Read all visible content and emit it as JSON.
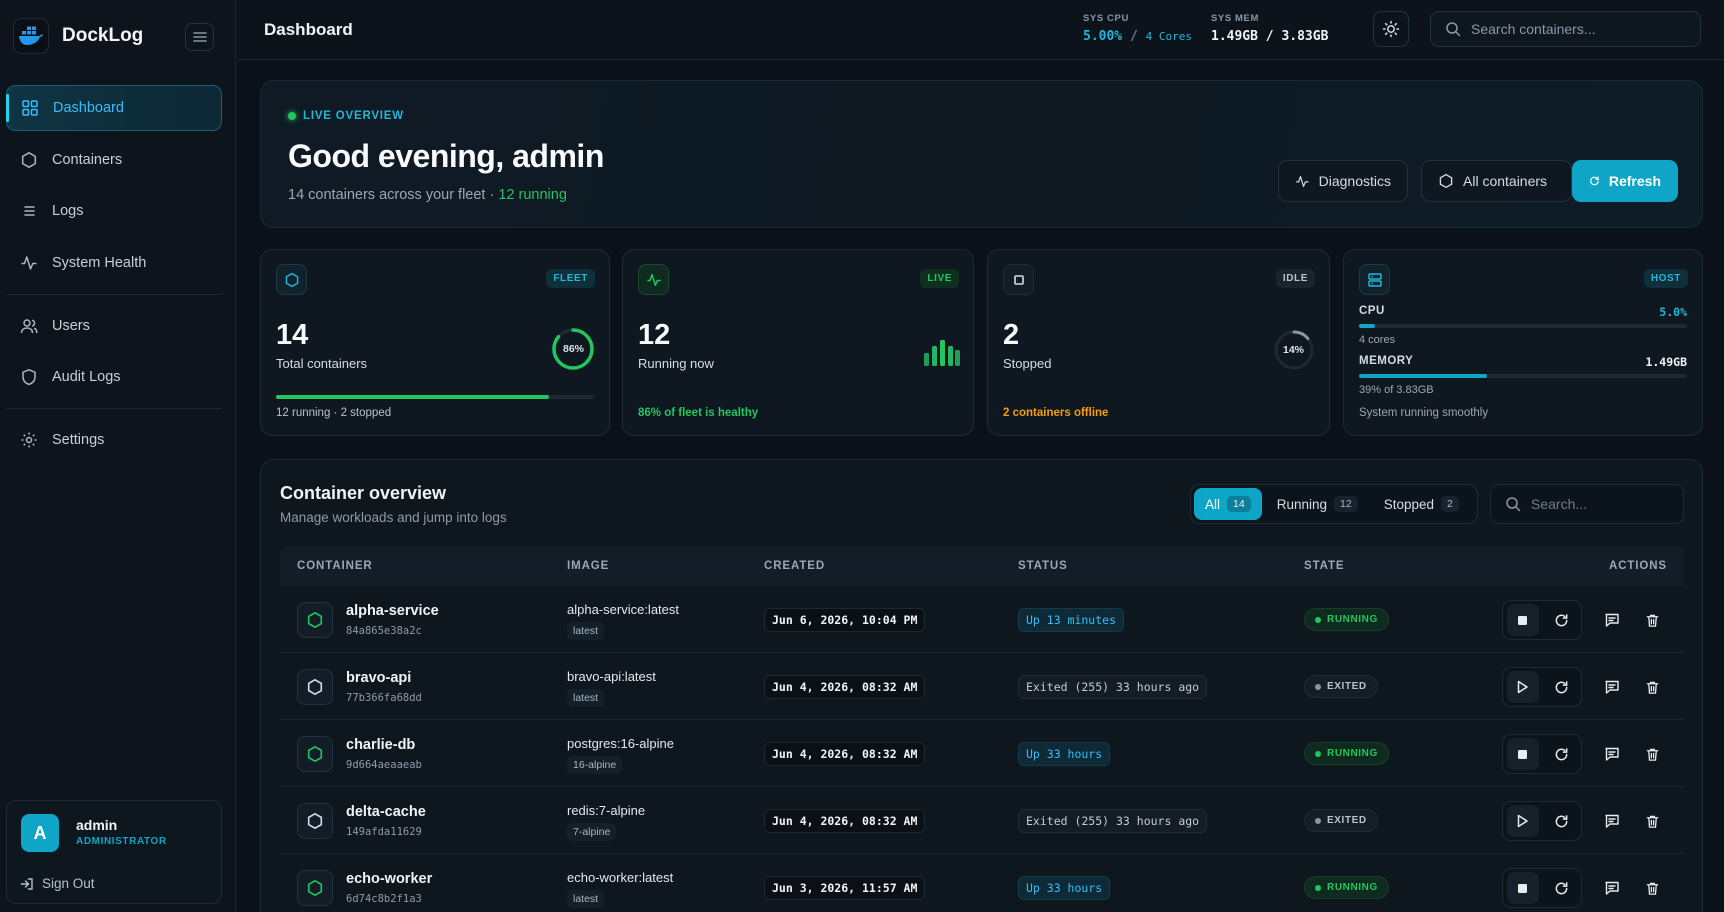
{
  "brand": {
    "name": "DockLog"
  },
  "sidebar": {
    "items": [
      {
        "label": "Dashboard",
        "icon": "grid-icon",
        "active": true
      },
      {
        "label": "Containers",
        "icon": "hexagon-icon"
      },
      {
        "label": "Logs",
        "icon": "list-icon"
      },
      {
        "label": "System Health",
        "icon": "activity-icon"
      },
      {
        "label": "Users",
        "icon": "users-icon"
      },
      {
        "label": "Audit Logs",
        "icon": "shield-icon"
      },
      {
        "label": "Settings",
        "icon": "gear-icon"
      }
    ],
    "user": {
      "initial": "A",
      "name": "admin",
      "role": "ADMINISTRATOR",
      "signout": "Sign Out"
    }
  },
  "topbar": {
    "title": "Dashboard",
    "cpu_label": "SYS CPU",
    "cpu_value": "5.00%",
    "cpu_sep": " / ",
    "cpu_cores": "4 Cores",
    "mem_label": "SYS MEM",
    "mem_value": "1.49GB / 3.83GB",
    "search_placeholder": "Search containers..."
  },
  "hero": {
    "tag": "LIVE OVERVIEW",
    "greeting": "Good evening, admin",
    "subtitle": "14 containers across your fleet ·",
    "running_text": "12 running",
    "buttons": {
      "diagnostics": "Diagnostics",
      "all_containers": "All containers",
      "refresh": "Refresh"
    }
  },
  "cards": {
    "fleet": {
      "pill": "FLEET",
      "value": "14",
      "label": "Total containers",
      "ring": "86%",
      "ring_pct": 86,
      "foot": "12 running · 2 stopped",
      "progress_pct": 86
    },
    "live": {
      "pill": "LIVE",
      "value": "12",
      "label": "Running now",
      "foot": "86% of fleet is healthy"
    },
    "idle": {
      "pill": "IDLE",
      "value": "2",
      "label": "Stopped",
      "ring": "14%",
      "ring_pct": 14,
      "foot": "2 containers offline"
    },
    "host": {
      "pill": "HOST",
      "cpu_label": "CPU",
      "cpu_value": "5.0%",
      "cpu_pct": 5,
      "cpu_sub": "4 cores",
      "mem_label": "MEMORY",
      "mem_value": "1.49GB",
      "mem_pct": 39,
      "mem_sub": "39% of 3.83GB",
      "foot": "System running smoothly"
    }
  },
  "overview": {
    "title": "Container overview",
    "subtitle": "Manage workloads and jump into logs",
    "filters": [
      {
        "label": "All",
        "count": "14",
        "active": true
      },
      {
        "label": "Running",
        "count": "12"
      },
      {
        "label": "Stopped",
        "count": "2"
      }
    ],
    "search_placeholder": "Search...",
    "columns": [
      "CONTAINER",
      "IMAGE",
      "CREATED",
      "STATUS",
      "STATE",
      "ACTIONS"
    ],
    "rows": [
      {
        "name": "alpha-service",
        "id": "84a865e38a2c",
        "image": "alpha-service:latest",
        "tag": "latest",
        "created": "Jun 6, 2026, 10:04 PM",
        "status": "Up 13 minutes",
        "state": "RUNNING"
      },
      {
        "name": "bravo-api",
        "id": "77b366fa68dd",
        "image": "bravo-api:latest",
        "tag": "latest",
        "created": "Jun 4, 2026, 08:32 AM",
        "status": "Exited (255) 33 hours ago",
        "state": "EXITED"
      },
      {
        "name": "charlie-db",
        "id": "9d664aeaaeab",
        "image": "postgres:16-alpine",
        "tag": "16-alpine",
        "created": "Jun 4, 2026, 08:32 AM",
        "status": "Up 33 hours",
        "state": "RUNNING"
      },
      {
        "name": "delta-cache",
        "id": "149afda11629",
        "image": "redis:7-alpine",
        "tag": "7-alpine",
        "created": "Jun 4, 2026, 08:32 AM",
        "status": "Exited (255) 33 hours ago",
        "state": "EXITED"
      },
      {
        "name": "echo-worker",
        "id": "6d74c8b2f1a3",
        "image": "echo-worker:latest",
        "tag": "latest",
        "created": "Jun 3, 2026, 11:57 AM",
        "status": "Up 33 hours",
        "state": "RUNNING"
      }
    ]
  },
  "colors": {
    "accent": "#0ea5c6",
    "green": "#22c55e",
    "orange": "#f59e0b",
    "bg": "#0b1118"
  }
}
